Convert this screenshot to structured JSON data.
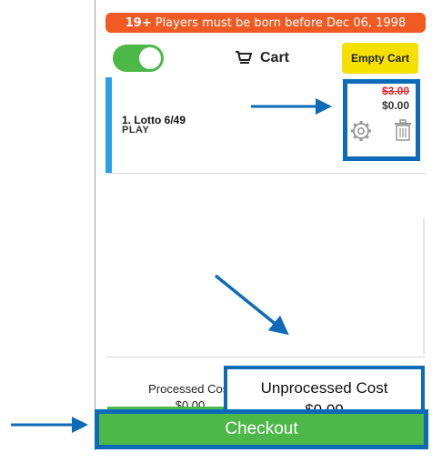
{
  "banner": {
    "age_prefix": "19+",
    "age_text": "Players must be born before Dec 06, 1998"
  },
  "header": {
    "cart_label": "Cart",
    "empty_cart_label": "Empty Cart"
  },
  "cart": {
    "items": [
      {
        "name": "1.  Lotto 6/49",
        "status": "PLAY",
        "original_price": "$3.00",
        "price": "$0.00"
      }
    ]
  },
  "summary": {
    "processed_label": "Processed Cost",
    "processed_value": "$0.00",
    "unprocessed_label": "Unprocessed Cost",
    "unprocessed_value": "$0.00"
  },
  "footer": {
    "checkout_label": "Checkout"
  },
  "colors": {
    "accent_green": "#4cb848",
    "annotation_blue": "#0d6ab8",
    "banner_orange": "#f25a24",
    "empty_cart_yellow": "#f6e000"
  }
}
